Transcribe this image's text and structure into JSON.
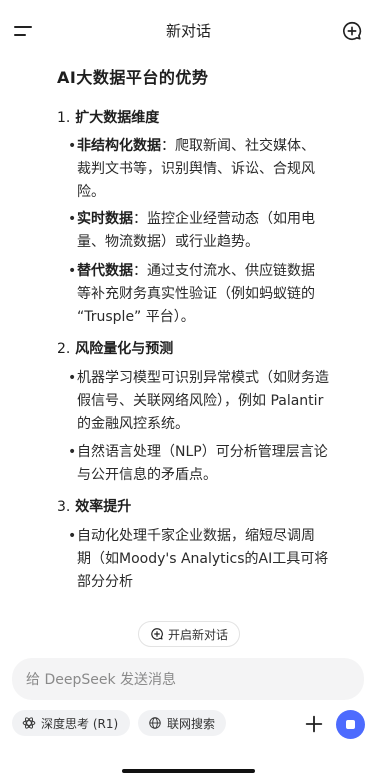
{
  "header": {
    "title": "新对话",
    "menu_icon": "hamburger-menu-icon",
    "new_chat_icon": "new-chat-plus-icon"
  },
  "content": {
    "heading": "AI大数据平台的优势",
    "sections": [
      {
        "number": "1.",
        "title": "扩大数据维度",
        "bullets": [
          {
            "bold": "非结构化数据",
            "text_lines": [
              "：爬取新闻、社交媒体、",
              "裁判文书等，识别舆情、诉讼、合规风",
              "险。"
            ]
          },
          {
            "bold": "实时数据",
            "text_lines": [
              "：监控企业经营动态（如用电",
              "量、物流数据）或行业趋势。"
            ]
          },
          {
            "bold": "替代数据",
            "text_lines": [
              "：通过支付流水、供应链数据",
              "等补充财务真实性验证（例如蚂蚁链的",
              "“Trusple” 平台）。"
            ]
          }
        ]
      },
      {
        "number": "2.",
        "title": "风险量化与预测",
        "bullets": [
          {
            "bold": "",
            "text_lines": [
              "机器学习模型可识别异常模式（如财务造",
              "假信号、关联网络风险），例如 Palantir",
              "的金融风控系统。"
            ]
          },
          {
            "bold": "",
            "text_lines": [
              "自然语言处理（NLP）可分析管理层言论",
              "与公开信息的矛盾点。"
            ]
          }
        ]
      },
      {
        "number": "3.",
        "title": "效率提升",
        "bullets": [
          {
            "bold": "",
            "text_lines": [
              "自动化处理千家企业数据，缩短尽调周",
              "期（如Moody's Analytics的AI工具可将",
              "部分分析"
            ]
          }
        ]
      }
    ]
  },
  "bottom": {
    "start_new_label": "开启新对话",
    "input_placeholder": "给 DeepSeek 发送消息",
    "deep_think_label": "深度思考 (R1)",
    "web_search_label": "联网搜索",
    "plus_icon": "plus-icon",
    "send_icon": "stop-send-icon",
    "accent_color": "#4d6bfe"
  }
}
